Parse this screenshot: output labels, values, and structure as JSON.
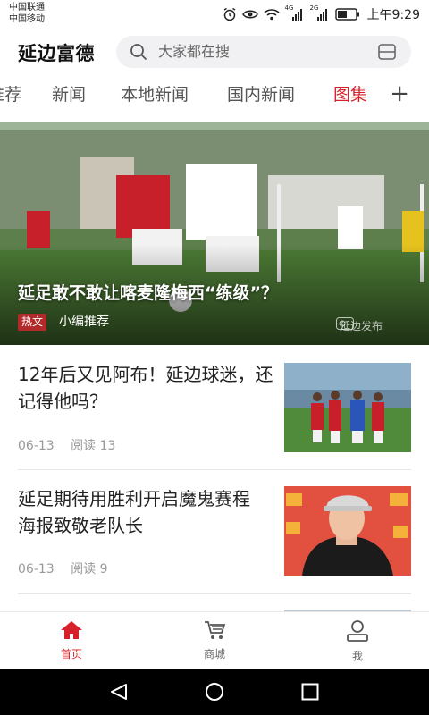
{
  "status": {
    "carrier1": "中国联通",
    "carrier2": "中国移动",
    "net1": "4G",
    "net2": "2G",
    "time": "上午9:29"
  },
  "header": {
    "title": "延边富德",
    "search_placeholder": "大家都在搜"
  },
  "tabs": [
    {
      "label": "推荐"
    },
    {
      "label": "新闻"
    },
    {
      "label": "本地新闻"
    },
    {
      "label": "国内新闻"
    },
    {
      "label": "图集",
      "active": true
    }
  ],
  "tab_add": "+",
  "hero": {
    "title": "延足敢不敢让喀麦隆梅西“练级”？",
    "tag": "热文",
    "source": "小编推荐",
    "watermark": "延边发布"
  },
  "news": [
    {
      "title": "12年后又见阿布！延边球迷，还记得他吗？",
      "date": "06-13",
      "reads": "阅读 13"
    },
    {
      "title": "延足期待用胜利开启魔鬼赛程 海报致敬老队长",
      "date": "06-13",
      "reads": "阅读 9"
    }
  ],
  "bottom_nav": [
    {
      "label": "首页",
      "icon": "home-icon",
      "active": true
    },
    {
      "label": "商城",
      "icon": "cart-icon"
    },
    {
      "label": "我",
      "icon": "profile-icon"
    }
  ],
  "colors": {
    "accent": "#d6212b",
    "tag": "#b22a2a"
  }
}
